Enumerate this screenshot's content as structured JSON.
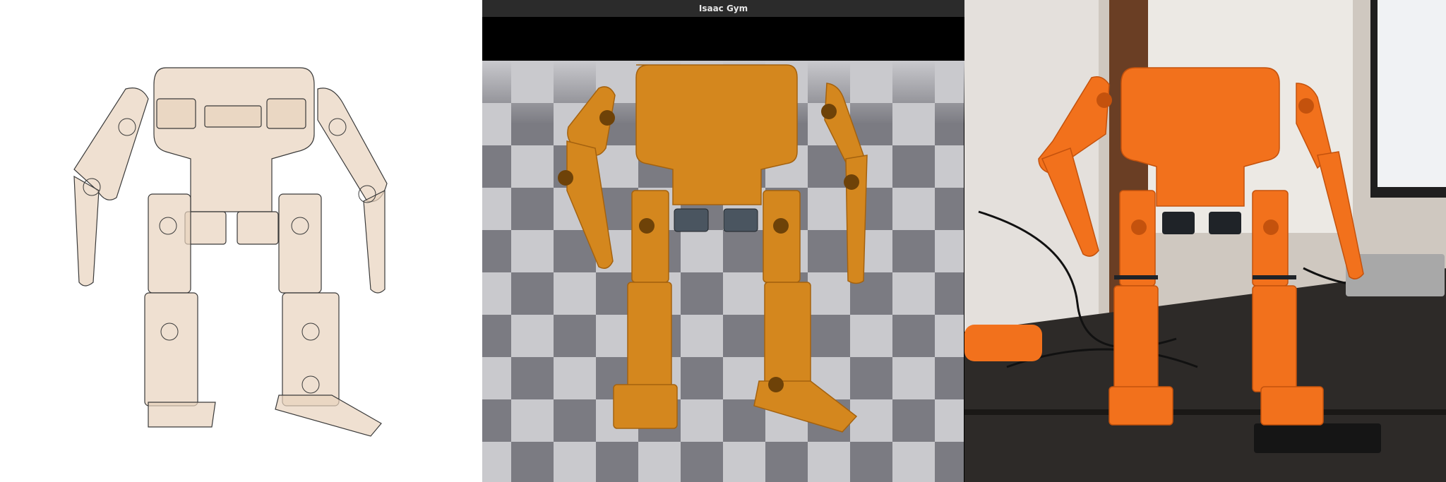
{
  "window": {
    "title": "Isaac Gym"
  },
  "panels": [
    {
      "id": "cad-wireframe",
      "description_key": "cad"
    },
    {
      "id": "isaac-gym-sim",
      "description_key": "sim"
    },
    {
      "id": "real-robot-photo",
      "description_key": "photo"
    }
  ],
  "colors": {
    "cad_fill": "#e8d3bd",
    "cad_stroke": "#3a3a3a",
    "sim_orange": "#d4871e",
    "sim_orange_dark": "#a4620f",
    "real_orange": "#f2711c",
    "real_orange_dark": "#c4520d",
    "floor_light": "#c9c9cd",
    "floor_dark": "#7b7b82",
    "table": "#2d2a28"
  }
}
